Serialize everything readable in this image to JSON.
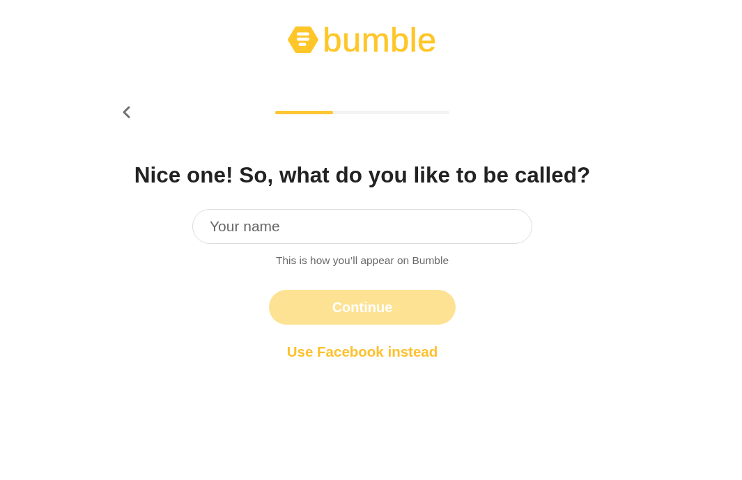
{
  "logo": {
    "wordmark": "bumble"
  },
  "progress": {
    "level": 0.333
  },
  "heading": "Nice one! So, what do you like to be called?",
  "name_field": {
    "placeholder": "Your name"
  },
  "hint": "This is how you’ll appear on Bumble",
  "continue_button": {
    "label": "Continue",
    "disabled": true
  },
  "alt_link": "Use Facebook instead"
}
